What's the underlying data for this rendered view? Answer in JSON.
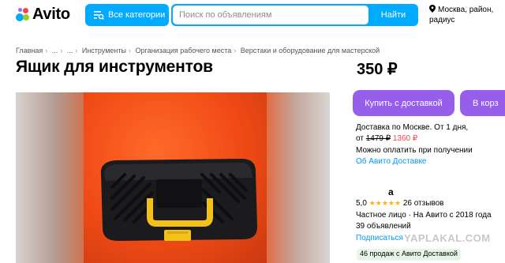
{
  "header": {
    "logo_text": "Avito",
    "categories_button": "Все категории",
    "search_placeholder": "Поиск по объявлениям",
    "find_button": "Найти",
    "location": "Москва, район, радиус"
  },
  "breadcrumb": [
    "Главная",
    "...",
    "...",
    "Инструменты",
    "Организация рабочего места",
    "Верстаки и оборудование для мастерской"
  ],
  "listing": {
    "title": "Ящик для инструментов",
    "price": "350 ₽"
  },
  "actions": {
    "buy_with_delivery": "Купить с доставкой",
    "cart": "В корз"
  },
  "delivery": {
    "line1": "Доставка по Москве. От 1 дня,",
    "from": "от",
    "old_price": "1479 ₽",
    "new_price": "1360 ₽",
    "pay_on_receipt": "Можно оплатить при получении",
    "about_link": "Об Авито Доставке"
  },
  "seller": {
    "name": "а",
    "rating": "5,0",
    "stars": "★★★★★",
    "reviews": "26 отзывов",
    "type_since": "Частное лицо · На Авито с 2018 года",
    "ads_count": "39 объявлений",
    "subscribe": "Подписаться",
    "sales_badge": "46 продаж с Авито Доставкой"
  },
  "watermark": "YAPLAKAL.COM",
  "colors": {
    "brand_blue": "#00aaff",
    "buy_purple": "#965eeb",
    "link_blue": "#0099f7",
    "sale_red": "#ff4053",
    "star_yellow": "#ffb021"
  }
}
